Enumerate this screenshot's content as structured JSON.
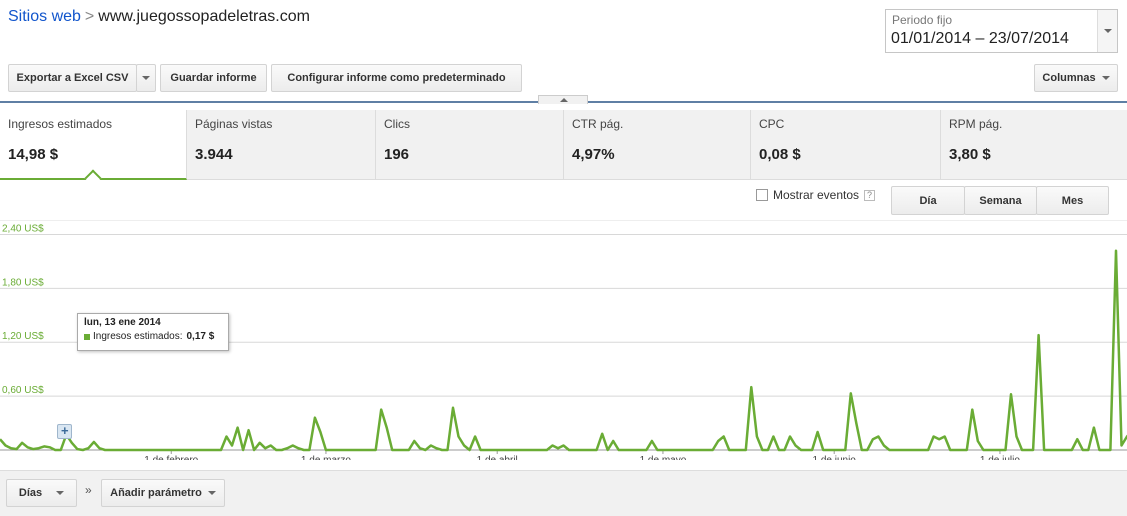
{
  "breadcrumb": {
    "root": "Sitios web",
    "separator": ">",
    "site": "www.juegossopadeletras.com"
  },
  "period": {
    "label": "Periodo fijo",
    "range": "01/01/2014 – 23/07/2014"
  },
  "toolbar": {
    "export_label": "Exportar a Excel CSV",
    "save_label": "Guardar informe",
    "default_label": "Configurar informe como predeterminado",
    "columns_label": "Columnas"
  },
  "metrics": [
    {
      "label": "Ingresos estimados",
      "value": "14,98 $"
    },
    {
      "label": "Páginas vistas",
      "value": "3.944"
    },
    {
      "label": "Clics",
      "value": "196"
    },
    {
      "label": "CTR pág.",
      "value": "4,97%"
    },
    {
      "label": "CPC",
      "value": "0,08 $"
    },
    {
      "label": "RPM pág.",
      "value": "3,80 $"
    }
  ],
  "events": {
    "label": "Mostrar eventos",
    "help": "?",
    "checked": false
  },
  "granularity": {
    "day": "Día",
    "week": "Semana",
    "month": "Mes"
  },
  "tooltip": {
    "date": "lun, 13 ene 2014",
    "series": "Ingresos estimados:",
    "value": "0,17 $"
  },
  "bottom": {
    "dimension": "Días",
    "separator": "»",
    "add_param": "Añadir parámetro"
  },
  "colors": {
    "series": "#6aac35",
    "accent": "#1155cc"
  },
  "chart_data": {
    "type": "line",
    "y_tick_labels": [
      "0,60 US$",
      "1,20 US$",
      "1,80 US$",
      "2,40 US$"
    ],
    "y_ticks": [
      0.6,
      1.2,
      1.8,
      2.4
    ],
    "ylim": [
      0,
      2.45
    ],
    "x_tick_labels": [
      "1 de febrero",
      "1 de marzo",
      "1 de abril",
      "1 de mayo",
      "1 de junio",
      "1 de julio"
    ],
    "x_tick_days": [
      31,
      59,
      90,
      120,
      151,
      181
    ],
    "x_days": 204,
    "series": [
      {
        "values": [
          0.12,
          0.05,
          0.02,
          0.01,
          0.08,
          0.03,
          0.01,
          0.02,
          0.04,
          0.03,
          0.0,
          0.0,
          0.17,
          0.08,
          0.01,
          0.0,
          0.02,
          0.09,
          0.02,
          0.0,
          0.0,
          0.0,
          0.0,
          0.0,
          0.0,
          0.0,
          0.0,
          0.0,
          0.0,
          0.0,
          0.0,
          0.0,
          0.0,
          0.0,
          0.0,
          0.0,
          0.0,
          0.0,
          0.0,
          0.0,
          0.0,
          0.15,
          0.05,
          0.25,
          0.0,
          0.22,
          0.0,
          0.08,
          0.02,
          0.05,
          0.0,
          0.0,
          0.02,
          0.05,
          0.02,
          0.0,
          0.0,
          0.36,
          0.2,
          0.0,
          0.0,
          0.0,
          0.0,
          0.0,
          0.0,
          0.0,
          0.0,
          0.0,
          0.0,
          0.45,
          0.25,
          0.0,
          0.0,
          0.0,
          0.0,
          0.1,
          0.02,
          0.0,
          0.05,
          0.02,
          0.0,
          0.0,
          0.47,
          0.15,
          0.05,
          0.0,
          0.15,
          0.0,
          0.0,
          0.0,
          0.0,
          0.0,
          0.0,
          0.0,
          0.0,
          0.0,
          0.0,
          0.0,
          0.0,
          0.0,
          0.05,
          0.02,
          0.05,
          0.0,
          0.0,
          0.0,
          0.0,
          0.0,
          0.0,
          0.18,
          0.0,
          0.1,
          0.0,
          0.0,
          0.0,
          0.0,
          0.0,
          0.0,
          0.1,
          0.0,
          0.0,
          0.0,
          0.0,
          0.0,
          0.0,
          0.0,
          0.0,
          0.0,
          0.0,
          0.0,
          0.1,
          0.15,
          0.0,
          0.0,
          0.0,
          0.0,
          0.7,
          0.15,
          0.0,
          0.0,
          0.15,
          0.0,
          0.0,
          0.15,
          0.05,
          0.0,
          0.0,
          0.0,
          0.2,
          0.0,
          0.0,
          0.0,
          0.0,
          0.0,
          0.63,
          0.3,
          0.0,
          0.0,
          0.12,
          0.15,
          0.05,
          0.0,
          0.0,
          0.0,
          0.0,
          0.0,
          0.0,
          0.0,
          0.0,
          0.15,
          0.12,
          0.15,
          0.0,
          0.0,
          0.0,
          0.0,
          0.45,
          0.1,
          0.0,
          0.0,
          0.0,
          0.0,
          0.0,
          0.62,
          0.15,
          0.0,
          0.0,
          0.0,
          1.28,
          0.0,
          0.0,
          0.0,
          0.0,
          0.0,
          0.0,
          0.12,
          0.0,
          0.0,
          0.25,
          0.0,
          0.0,
          0.0,
          2.22,
          0.05,
          0.15,
          0.22,
          0.0,
          0.05,
          0.0,
          0.0,
          0.0,
          0.0,
          0.0,
          0.05,
          0.12,
          0.0,
          0.0,
          0.0
        ]
      }
    ]
  }
}
